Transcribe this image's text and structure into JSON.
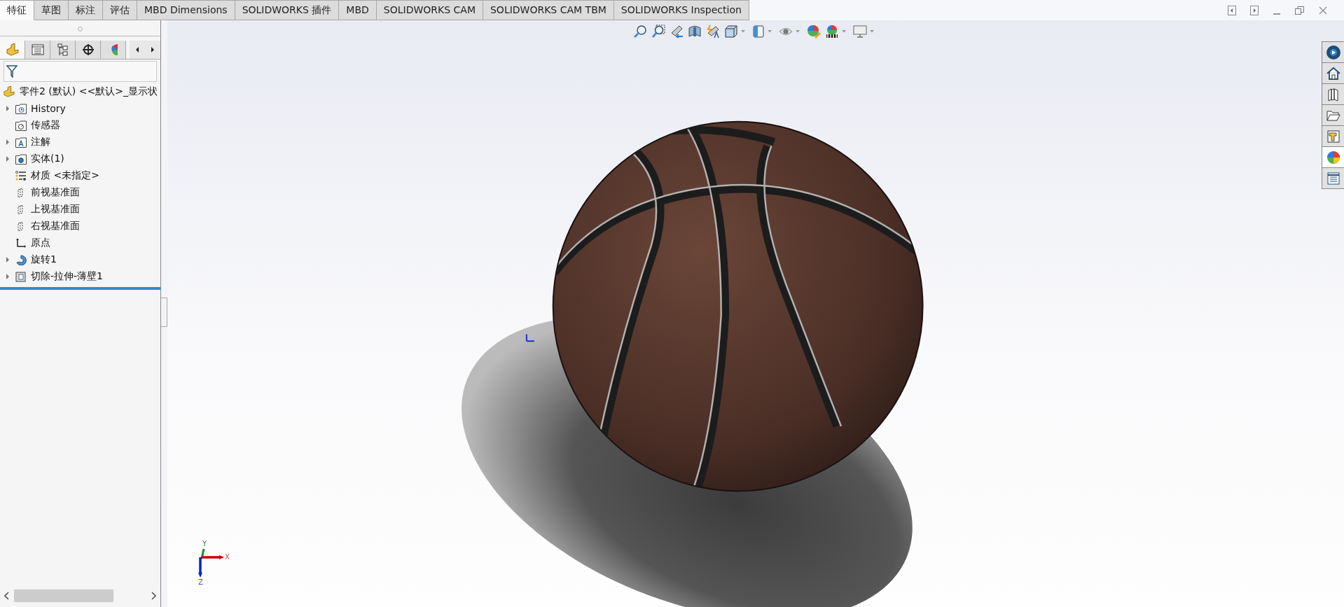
{
  "tabs": [
    {
      "label": "特征",
      "selected": true
    },
    {
      "label": "草图",
      "selected": false
    },
    {
      "label": "标注",
      "selected": false
    },
    {
      "label": "评估",
      "selected": false
    },
    {
      "label": "MBD Dimensions",
      "selected": false
    },
    {
      "label": "SOLIDWORKS 插件",
      "selected": false
    },
    {
      "label": "MBD",
      "selected": false
    },
    {
      "label": "SOLIDWORKS CAM",
      "selected": false
    },
    {
      "label": "SOLIDWORKS CAM TBM",
      "selected": false
    },
    {
      "label": "SOLIDWORKS Inspection",
      "selected": false
    }
  ],
  "panel_tabs": [
    {
      "kind": "feature",
      "selected": true
    },
    {
      "kind": "property",
      "selected": false
    },
    {
      "kind": "config",
      "selected": false
    },
    {
      "kind": "dimxpert",
      "selected": false
    },
    {
      "kind": "display",
      "selected": false
    }
  ],
  "tree": {
    "root": "零件2 (默认) <<默认>_显示状",
    "items": [
      {
        "label": "History",
        "kind": "history",
        "expanded": false
      },
      {
        "label": "传感器",
        "kind": "sensor"
      },
      {
        "label": "注解",
        "kind": "annotation",
        "expanded": false
      },
      {
        "label": "实体(1)",
        "kind": "solid",
        "expanded": false
      },
      {
        "label": "材质 <未指定>",
        "kind": "material"
      },
      {
        "label": "前视基准面",
        "kind": "plane"
      },
      {
        "label": "上视基准面",
        "kind": "plane"
      },
      {
        "label": "右视基准面",
        "kind": "plane"
      },
      {
        "label": "原点",
        "kind": "origin"
      },
      {
        "label": "旋转1",
        "kind": "revolve",
        "expanded": false
      },
      {
        "label": "切除-拉伸-薄壁1",
        "kind": "cut",
        "expanded": false
      }
    ]
  },
  "toolbar": [
    {
      "kind": "zoom-fit",
      "dropdown": false
    },
    {
      "kind": "zoom-area",
      "dropdown": false
    },
    {
      "kind": "previous-view",
      "dropdown": false
    },
    {
      "kind": "section",
      "dropdown": false
    },
    {
      "kind": "dynamic-annotation",
      "dropdown": false
    },
    {
      "kind": "view-orientation",
      "dropdown": true
    },
    {
      "kind": "display-style",
      "dropdown": true
    },
    {
      "kind": "hide-show",
      "dropdown": true
    },
    {
      "kind": "edit-appearance",
      "dropdown": false
    },
    {
      "kind": "scene",
      "dropdown": true
    },
    {
      "kind": "view-settings",
      "dropdown": true
    }
  ],
  "task_pane": [
    {
      "kind": "resources",
      "selected": false
    },
    {
      "kind": "home",
      "selected": false
    },
    {
      "kind": "library",
      "selected": false
    },
    {
      "kind": "explorer",
      "selected": false
    },
    {
      "kind": "palette",
      "selected": false
    },
    {
      "kind": "appearance",
      "selected": true
    },
    {
      "kind": "properties",
      "selected": false
    }
  ],
  "triad": {
    "x": "X",
    "y": "Y",
    "z": "Z"
  }
}
